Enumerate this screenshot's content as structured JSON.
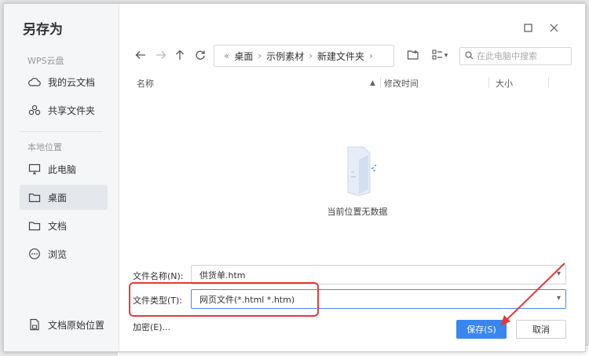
{
  "dialog": {
    "title": "另存为",
    "window_controls": {
      "maximize_icon": "square-icon",
      "close_icon": "close-icon"
    }
  },
  "sidebar": {
    "cloud_section": "WPS云盘",
    "cloud_items": [
      {
        "label": "我的云文档",
        "icon": "cloud-icon"
      },
      {
        "label": "共享文件夹",
        "icon": "share-icon"
      }
    ],
    "local_section": "本地位置",
    "local_items": [
      {
        "label": "此电脑",
        "icon": "monitor-icon"
      },
      {
        "label": "桌面",
        "icon": "folder-icon",
        "active": true
      },
      {
        "label": "文档",
        "icon": "folder-icon"
      },
      {
        "label": "浏览",
        "icon": "more-icon"
      }
    ],
    "bottom_item": {
      "label": "文档原始位置",
      "icon": "document-icon"
    }
  },
  "toolbar": {
    "breadcrumb": [
      "桌面",
      "示例素材",
      "新建文件夹"
    ],
    "search_placeholder": "在此电脑中搜索"
  },
  "columns": {
    "name": "名称",
    "modified": "修改时间",
    "size": "大小"
  },
  "empty_state": {
    "text": "当前位置无数据",
    "icon": "empty-folder-icon"
  },
  "form": {
    "filename_label": "文件名称(N):",
    "filename_value": "供货单.htm",
    "filetype_label": "文件类型(T):",
    "filetype_value": "网页文件(*.html *.htm)",
    "encrypt_label": "加密(E)..."
  },
  "buttons": {
    "save": "保存(S)",
    "cancel": "取消"
  },
  "colors": {
    "accent": "#3a86f0",
    "annotation": "#e53935"
  }
}
